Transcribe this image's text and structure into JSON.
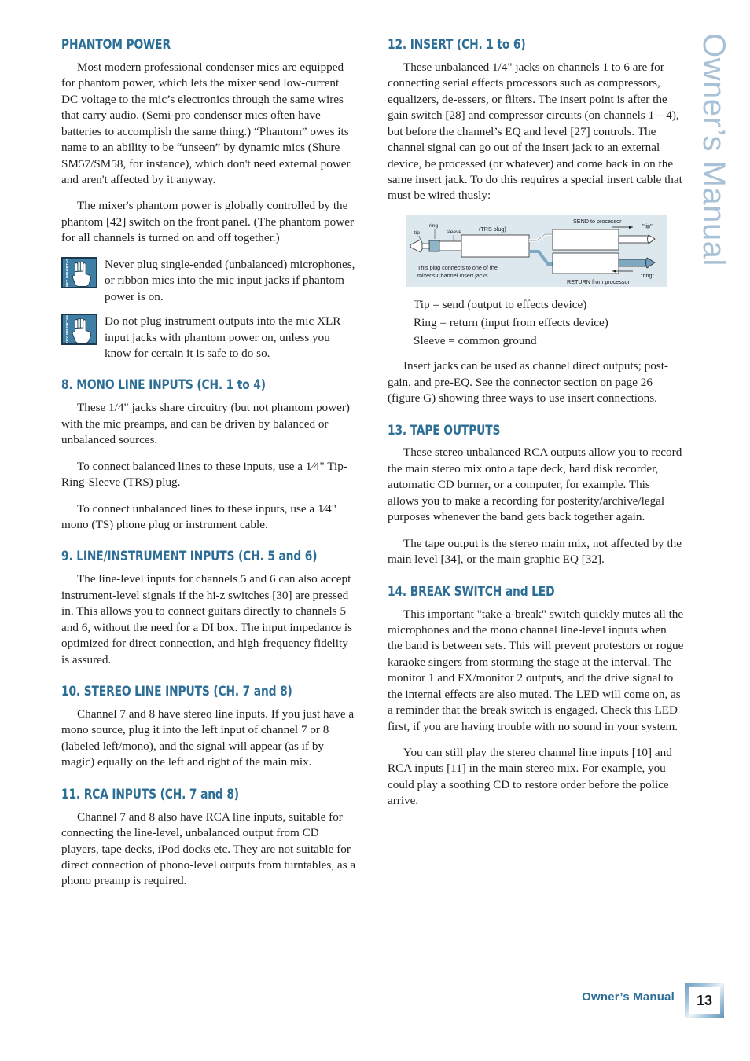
{
  "colors": {
    "heading_blue": "#2d6e96",
    "body_text": "#231f20",
    "edge_title_blue": "#a9c1d6",
    "diagram_bg": "#dce8ee",
    "warning_icon_bg": "#3f7fa5"
  },
  "edge_title": "Owner’s Manual",
  "footer": {
    "label": "Owner’s Manual",
    "page_number": "13"
  },
  "left_column": {
    "section_phantom": {
      "heading": "PHANTOM POWER",
      "paragraphs": [
        "Most modern professional condenser mics are equipped for phantom power, which lets the mixer send low-current DC voltage to the mic’s electronics through the same wires that carry audio. (Semi-pro condenser mics often have batteries to accomplish the same thing.) “Phantom” owes its name to an ability to be “unseen” by dynamic mics (Shure SM57/SM58, for instance), which don't need external power and aren't affected by it anyway.",
        "The mixer's phantom power is globally controlled by the phantom [42] switch on the front panel. (The phantom power for all channels is turned on and off together.)"
      ],
      "warnings": [
        {
          "icon_label": "VERY IMPORTANT",
          "text": "Never plug single-ended (unbalanced) microphones, or ribbon mics into the mic input jacks if phantom power is on."
        },
        {
          "icon_label": "VERY IMPORTANT",
          "text": "Do not plug instrument outputs into the mic XLR input jacks with phantom power on, unless you know for certain it is safe to do so."
        }
      ]
    },
    "section_8": {
      "heading": "8. MONO LINE INPUTS (CH. 1 to 4)",
      "paragraphs": [
        "These 1/4\" jacks share circuitry (but not phantom power) with the mic preamps, and can be driven by balanced or unbalanced sources.",
        "To connect balanced lines to these inputs, use a 1⁄4\" Tip-Ring-Sleeve (TRS) plug.",
        "To connect unbalanced lines to these inputs, use a 1⁄4\" mono (TS) phone plug or instrument cable."
      ]
    },
    "section_9": {
      "heading": "9. LINE/INSTRUMENT INPUTS (CH. 5 and 6)",
      "paragraphs": [
        "The line-level inputs for channels 5 and 6 can also accept instrument-level signals if the hi-z switches [30] are pressed in. This allows you to connect guitars directly to channels 5 and 6, without the need for a DI box. The input impedance is optimized for direct connection, and high-frequency fidelity is assured."
      ]
    },
    "section_10": {
      "heading": "10. STEREO LINE INPUTS (CH. 7 and 8)",
      "paragraphs": [
        "Channel 7 and 8 have stereo line inputs. If you just have a mono source, plug it into the left input of channel 7 or 8 (labeled left/mono), and the signal will appear (as if by magic) equally on the left and right of the main mix."
      ]
    },
    "section_11": {
      "heading": "11. RCA INPUTS (CH. 7 and 8)",
      "paragraphs": [
        "Channel 7 and 8 also have RCA line inputs, suitable for connecting the line-level, unbalanced output from CD players, tape decks, iPod docks etc. They are not suitable for direct connection of phono-level outputs from turntables, as a phono preamp is required."
      ]
    }
  },
  "right_column": {
    "section_12": {
      "heading": "12. INSERT (CH. 1 to 6)",
      "paragraphs_before_diagram": [
        "These unbalanced 1/4\" jacks on channels 1 to 6 are for connecting serial effects processors such as compressors, equalizers, de-essers, or filters. The insert point is after the gain switch [28] and compressor circuits (on channels 1 – 4), but before the channel’s EQ and level [27] controls. The channel signal can go out of the insert jack to an external device, be processed (or whatever) and come back in on the same insert jack. To do this requires a special insert cable that must be wired thusly:"
      ],
      "diagram": {
        "label_tip": "tip",
        "label_ring": "ring",
        "label_sleeve": "sleeve",
        "label_trs_plug": "(TRS plug)",
        "caption_line1": "This plug connects to one of the",
        "caption_line2": "mixer's Channel Insert jacks.",
        "label_send": "SEND to processor",
        "label_return": "RETURN from processor",
        "label_tip_quoted": "\"tip\"",
        "label_ring_quoted": "\"ring\""
      },
      "definitions": [
        "Tip = send (output to effects device)",
        "Ring = return (input from effects device)",
        "Sleeve = common ground"
      ],
      "paragraphs_after_diagram": [
        "Insert jacks can be used as channel direct outputs; post-gain, and pre-EQ. See the connector section on page 26 (figure G) showing three ways to use insert connections."
      ]
    },
    "section_13": {
      "heading": "13. TAPE OUTPUTS",
      "paragraphs": [
        "These stereo unbalanced RCA outputs allow you to record the main stereo mix onto a tape deck, hard disk recorder, automatic CD burner, or a computer, for example. This allows you to make a recording for posterity/archive/legal purposes whenever the band gets back together again.",
        "The tape output is the stereo main mix, not affected by the main level [34], or the main graphic EQ [32]."
      ]
    },
    "section_14": {
      "heading": "14. BREAK SWITCH and LED",
      "paragraphs": [
        "This important \"take-a-break\" switch quickly mutes all the microphones and the mono channel line-level inputs when the band is between sets. This will prevent protestors or rogue karaoke singers from storming the stage at the interval. The monitor 1 and FX/monitor 2 outputs, and the drive signal to the internal effects are also muted. The LED will come on, as a reminder that the break switch is engaged. Check this LED first, if you are having trouble with no sound in your system.",
        "You can still play the stereo channel line inputs [10] and RCA inputs [11] in the main stereo mix. For example, you could play a soothing CD to restore order before the police arrive."
      ]
    }
  }
}
